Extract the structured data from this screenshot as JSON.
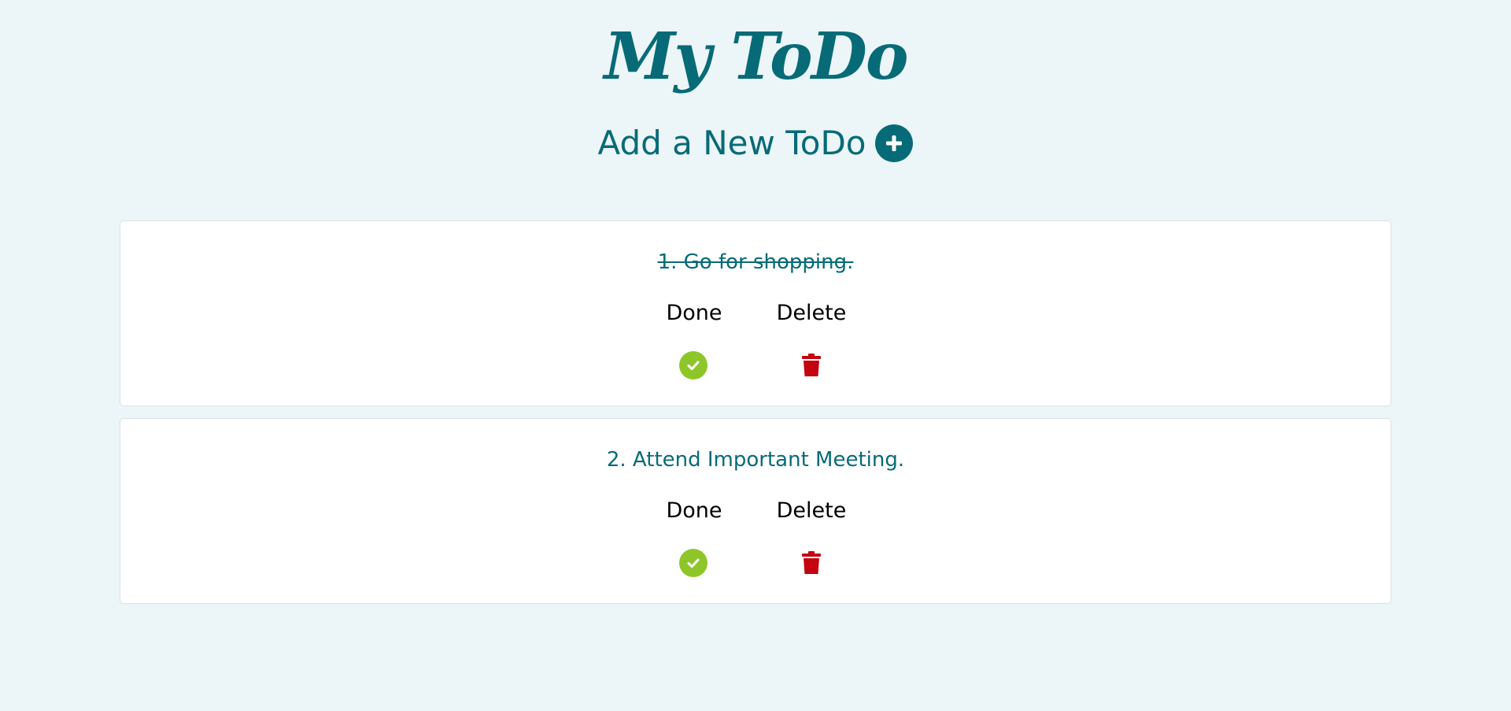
{
  "header": {
    "title": "My ToDo",
    "add_label": "Add a New ToDo"
  },
  "todos": [
    {
      "text": "1. Go for shopping.",
      "completed": true,
      "done_label": "Done",
      "delete_label": "Delete"
    },
    {
      "text": "2. Attend Important Meeting.",
      "completed": false,
      "done_label": "Done",
      "delete_label": "Delete"
    }
  ],
  "colors": {
    "background": "#ecf5f8",
    "primary": "#076b77",
    "done_icon": "#8ec62a",
    "delete_icon": "#c4040f",
    "card": "#ffffff"
  },
  "icons": {
    "add": "plus-circle-icon",
    "done": "check-circle-icon",
    "delete": "trash-icon"
  }
}
